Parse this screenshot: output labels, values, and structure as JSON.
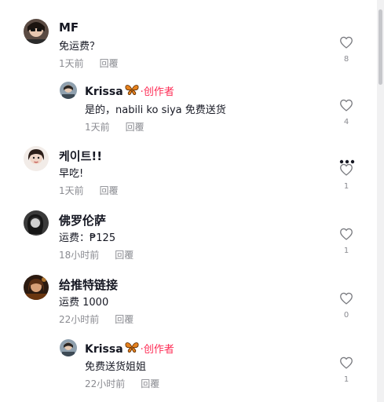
{
  "comments": [
    {
      "name": "MF",
      "text": "免运费？",
      "time": "1天前",
      "reply": "回覆",
      "likes": "8"
    },
    {
      "name": "Krissa",
      "badge": "创作者",
      "text": "是的，nabili ko siya 免费送货",
      "time": "1天前",
      "reply": "回覆",
      "likes": "4"
    },
    {
      "name": "케이트!!",
      "text": "早吃!",
      "time": "1天前",
      "reply": "回覆",
      "likes": "1"
    },
    {
      "name": "佛罗伦萨",
      "text": "运费：₱125",
      "time": "18小时前",
      "reply": "回覆",
      "likes": "1"
    },
    {
      "name": "给推特链接",
      "text": "运费 1000",
      "time": "22小时前",
      "reply": "回覆",
      "likes": "0"
    },
    {
      "name": "Krissa",
      "badge": "创作者",
      "text": "免费送货姐姐",
      "time": "22小时前",
      "reply": "回覆",
      "likes": "1"
    }
  ],
  "icons": {
    "like": "heart-outline-icon",
    "more": "more-dots-icon",
    "badge": "butterfly-icon"
  },
  "colors": {
    "creator": "#fe2c55",
    "meta": "#8a8b91",
    "text": "#161823"
  }
}
